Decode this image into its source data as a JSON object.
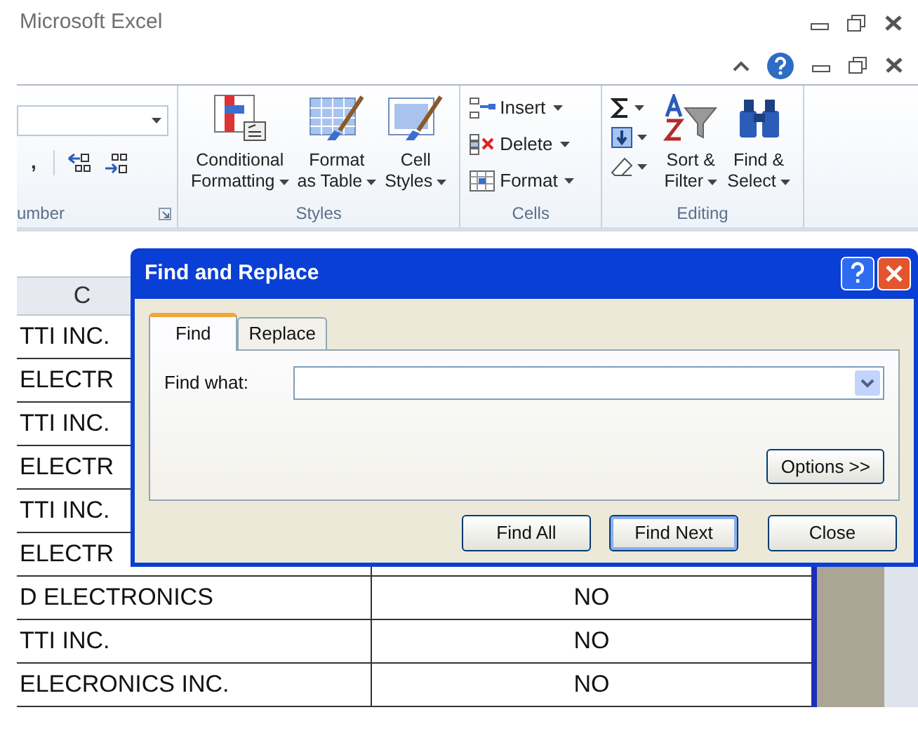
{
  "window": {
    "title": "Microsoft Excel"
  },
  "ribbon": {
    "groups": [
      {
        "kind": "number",
        "label": "umber",
        "comma": ","
      },
      {
        "kind": "styles",
        "label": "Styles",
        "buttons": [
          {
            "kind": "conditional",
            "line1": "Conditional",
            "line2": "Formatting"
          },
          {
            "kind": "table",
            "line1": "Format",
            "line2": "as Table"
          },
          {
            "kind": "cellstyles",
            "line1": "Cell",
            "line2": "Styles"
          }
        ]
      },
      {
        "kind": "cells",
        "label": "Cells",
        "buttons": [
          {
            "kind": "insert",
            "label": "Insert"
          },
          {
            "kind": "delete",
            "label": "Delete"
          },
          {
            "kind": "format",
            "label": "Format"
          }
        ]
      },
      {
        "kind": "editing",
        "label": "Editing",
        "buttons": [
          {
            "kind": "sort",
            "line1": "Sort &",
            "line2": "Filter"
          },
          {
            "kind": "find",
            "line1": "Find &",
            "line2": "Select"
          }
        ]
      }
    ]
  },
  "sheet": {
    "column_header": "C",
    "rows": [
      {
        "cells": [
          "TTI INC."
        ]
      },
      {
        "cells": [
          "ELECTR"
        ]
      },
      {
        "cells": [
          "TTI INC."
        ]
      },
      {
        "cells": [
          "ELECTR"
        ]
      },
      {
        "cells": [
          "TTI INC."
        ]
      },
      {
        "cells": [
          "ELECTR"
        ]
      },
      {
        "cells": [
          "D ELECTRONICS",
          "NO"
        ]
      },
      {
        "cells": [
          "TTI INC.",
          "NO"
        ]
      },
      {
        "cells": [
          "ELECRONICS INC.",
          "NO"
        ]
      }
    ]
  },
  "dialog": {
    "title": "Find and Replace",
    "tabs": [
      {
        "label": "Find",
        "selected": true
      },
      {
        "label": "Replace",
        "selected": false
      }
    ],
    "field_label": "Find what:",
    "options_button": "Options >>",
    "buttons": [
      {
        "label": "Find All",
        "default": false
      },
      {
        "label": "Find Next",
        "default": true
      },
      {
        "label": "Close",
        "default": false
      }
    ]
  }
}
